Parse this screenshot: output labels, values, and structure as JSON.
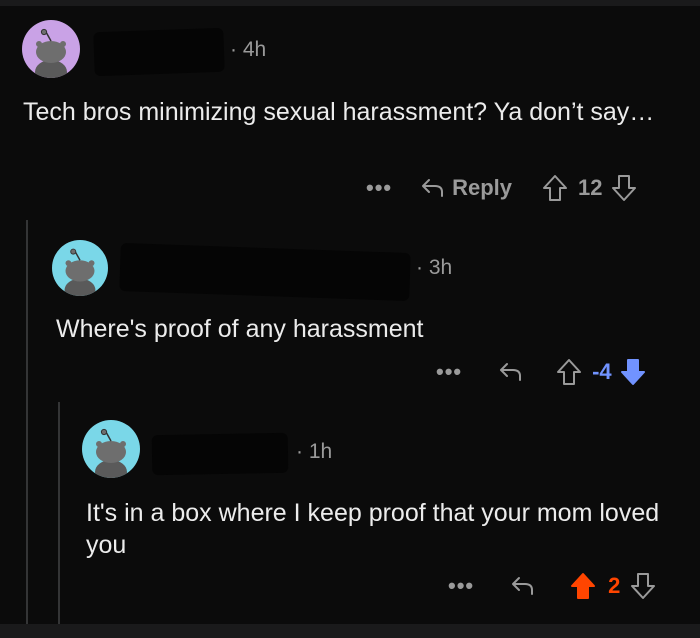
{
  "comments": [
    {
      "timestamp": "· 4h",
      "text": "Tech bros minimizing sexual harassment? Ya don’t say…",
      "actions": {
        "more": "•••",
        "reply_label": "Reply",
        "score": "12",
        "vote_state": "none"
      },
      "avatar_color": "#c9a2e6"
    },
    {
      "timestamp": "· 3h",
      "text": "Where's proof of any harassment",
      "actions": {
        "more": "•••",
        "score": "-4",
        "vote_state": "downvoted"
      },
      "avatar_color": "#7ad7e8"
    },
    {
      "timestamp": "· 1h",
      "text": "It's in a box where I keep proof that your mom loved you",
      "actions": {
        "more": "•••",
        "score": "2",
        "vote_state": "upvoted"
      },
      "avatar_color": "#7ad7e8"
    }
  ],
  "colors": {
    "upvote": "#ff4500",
    "downvote": "#7193ff",
    "neutral": "#9a9a9a"
  }
}
